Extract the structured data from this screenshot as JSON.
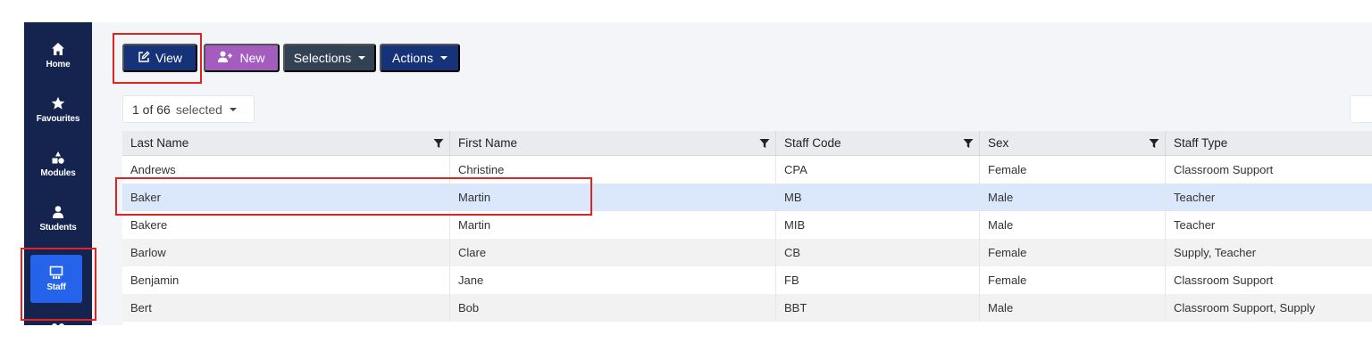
{
  "sidebar": {
    "items": [
      {
        "label": "Home",
        "icon": "home-icon"
      },
      {
        "label": "Favourites",
        "icon": "star-icon"
      },
      {
        "label": "Modules",
        "icon": "modules-icon"
      },
      {
        "label": "Students",
        "icon": "person-icon"
      },
      {
        "label": "Staff",
        "icon": "staff-icon",
        "active": true
      }
    ]
  },
  "toolbar": {
    "view_label": "View",
    "new_label": "New",
    "selections_label": "Selections",
    "actions_label": "Actions"
  },
  "selection": {
    "count_text": "1 of 66",
    "suffix": "selected"
  },
  "table": {
    "columns": [
      "Last Name",
      "First Name",
      "Staff Code",
      "Sex",
      "Staff Type"
    ],
    "rows": [
      [
        "Andrews",
        "Christine",
        "CPA",
        "Female",
        "Classroom Support"
      ],
      [
        "Baker",
        "Martin",
        "MB",
        "Male",
        "Teacher"
      ],
      [
        "Bakere",
        "Martin",
        "MIB",
        "Male",
        "Teacher"
      ],
      [
        "Barlow",
        "Clare",
        "CB",
        "Female",
        "Supply, Teacher"
      ],
      [
        "Benjamin",
        "Jane",
        "FB",
        "Female",
        "Classroom Support"
      ],
      [
        "Bert",
        "Bob",
        "BBT",
        "Male",
        "Classroom Support, Supply"
      ]
    ],
    "selected_row": 1
  },
  "colors": {
    "sidebar_bg": "#14244f",
    "active_nav": "#2563eb",
    "primary": "#16337a",
    "new_button": "#a45dbf",
    "selections_button": "#334155",
    "highlight": "#e02424",
    "selected_row": "#dbe7fb"
  }
}
